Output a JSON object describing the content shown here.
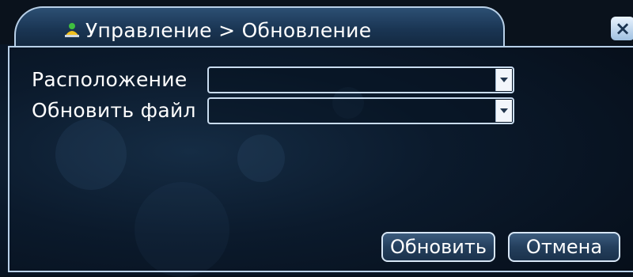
{
  "window": {
    "title": "Управление > Обновление",
    "title_icon": "user-tree-icon",
    "close_icon": "close-icon",
    "close_glyph": "×"
  },
  "form": {
    "location_label": "Расположение",
    "location_value": "",
    "update_file_label": "Обновить файл",
    "update_file_value": ""
  },
  "buttons": {
    "update_label": "Обновить",
    "cancel_label": "Отмена"
  },
  "colors": {
    "accent_border": "#b8d0e8",
    "tab_fill": "#1a3553",
    "background": "#0b1a2c"
  }
}
